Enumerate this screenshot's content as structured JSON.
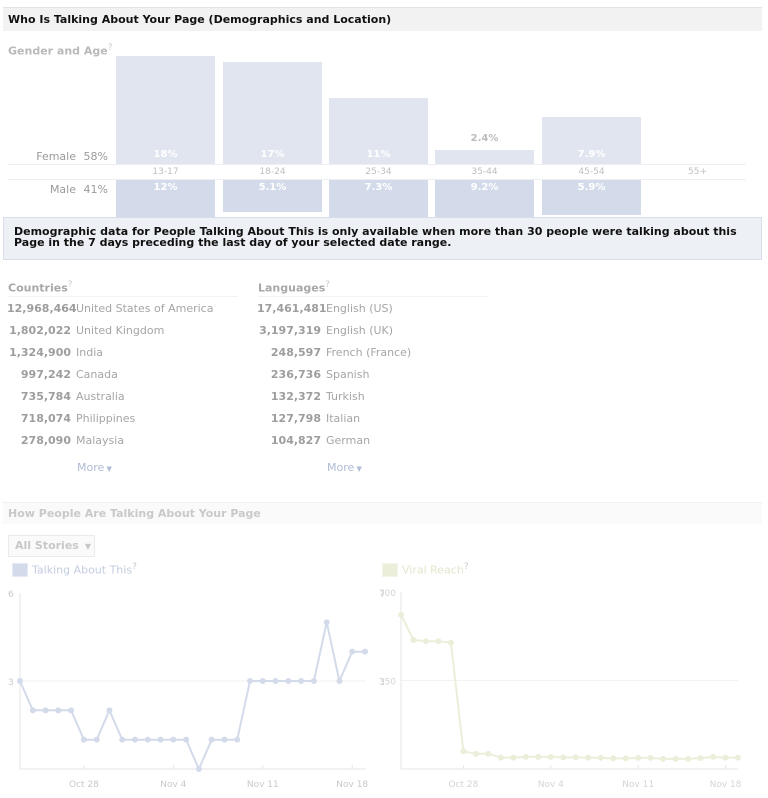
{
  "header": {
    "title": "Who Is Talking About Your Page (Demographics and Location)"
  },
  "gender_age": {
    "title": "Gender and Age",
    "help": "?",
    "female_label": "Female",
    "female_pct": "58%",
    "male_label": "Male",
    "male_pct": "41%",
    "groups": [
      {
        "age": "13-17",
        "female": "18%",
        "male": "12%",
        "female_value": 18,
        "male_value": 12
      },
      {
        "age": "18-24",
        "female": "17%",
        "male": "5.1%",
        "female_value": 17,
        "male_value": 5.1
      },
      {
        "age": "25-34",
        "female": "11%",
        "male": "7.3%",
        "female_value": 11,
        "male_value": 7.3
      },
      {
        "age": "35-44",
        "female": "2.4%",
        "male": "9.2%",
        "female_value": 2.4,
        "male_value": 9.2
      },
      {
        "age": "45-54",
        "female": "7.9%",
        "male": "5.9%",
        "female_value": 7.9,
        "male_value": 5.9
      },
      {
        "age": "55+",
        "female": "",
        "male": "",
        "female_value": 0,
        "male_value": 0
      }
    ]
  },
  "notice": "Demographic data for People Talking About This is only available when more than 30 people were talking about this Page in the 7 days preceding the last day of your selected date range.",
  "countries": {
    "title": "Countries",
    "help": "?",
    "items": [
      {
        "count": "12,968,464",
        "name": "United States of America"
      },
      {
        "count": "1,802,022",
        "name": "United Kingdom"
      },
      {
        "count": "1,324,900",
        "name": "India"
      },
      {
        "count": "997,242",
        "name": "Canada"
      },
      {
        "count": "735,784",
        "name": "Australia"
      },
      {
        "count": "718,074",
        "name": "Philippines"
      },
      {
        "count": "278,090",
        "name": "Malaysia"
      }
    ],
    "more": "More"
  },
  "languages": {
    "title": "Languages",
    "help": "?",
    "items": [
      {
        "count": "17,461,481",
        "name": "English (US)"
      },
      {
        "count": "3,197,319",
        "name": "English (UK)"
      },
      {
        "count": "248,597",
        "name": "French (France)"
      },
      {
        "count": "236,736",
        "name": "Spanish"
      },
      {
        "count": "132,372",
        "name": "Turkish"
      },
      {
        "count": "127,798",
        "name": "Italian"
      },
      {
        "count": "104,827",
        "name": "German"
      }
    ],
    "more": "More"
  },
  "talking": {
    "title": "How People Are Talking About Your Page",
    "dropdown": "All Stories"
  },
  "colors": {
    "talking_line": "#d3dbea",
    "viral_line": "#ebefd9",
    "female_bar": "#e1e5ef",
    "male_bar": "#d3dbea"
  },
  "chart_data": [
    {
      "type": "line",
      "title": "Talking About This",
      "help": "?",
      "ylim": [
        0,
        6
      ],
      "yticks": [
        "6",
        "3"
      ],
      "y2ticks": [
        "7",
        "3"
      ],
      "xticks": [
        "Oct 28",
        "Nov 4",
        "Nov 11",
        "Nov 18"
      ],
      "xtick_index": [
        5,
        12,
        19,
        26
      ],
      "values": [
        3,
        2,
        2,
        2,
        2,
        1,
        1,
        2,
        1,
        1,
        1,
        1,
        1,
        1,
        0,
        1,
        1,
        1,
        3,
        3,
        3,
        3,
        3,
        3,
        5,
        3,
        4,
        4
      ]
    },
    {
      "type": "line",
      "title": "Viral Reach",
      "help": "?",
      "ylim": [
        0,
        700
      ],
      "yticks": [
        "700",
        "350"
      ],
      "xticks": [
        "Oct 28",
        "Nov 4",
        "Nov 11",
        "Nov 18"
      ],
      "xtick_index": [
        5,
        12,
        19,
        26
      ],
      "values": [
        610,
        510,
        505,
        505,
        500,
        70,
        60,
        60,
        45,
        45,
        48,
        48,
        48,
        46,
        46,
        45,
        44,
        42,
        42,
        44,
        44,
        40,
        40,
        40,
        43,
        48,
        45,
        45
      ]
    }
  ]
}
